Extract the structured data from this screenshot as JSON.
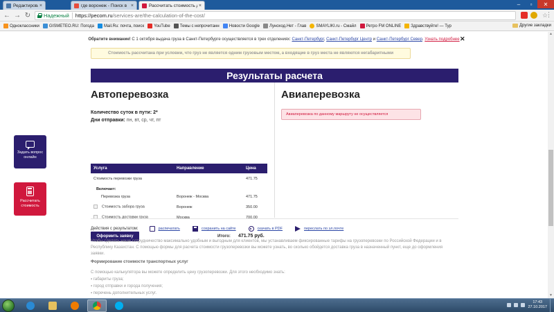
{
  "browser": {
    "tabs": [
      {
        "title": "Редактировать сообщ",
        "favicon_color": "#4a76a8",
        "active": false
      },
      {
        "title": "где воронеж - Поиск в",
        "favicon_color": "#e74c3c",
        "active": false
      },
      {
        "title": "Рассчитать стоимость д",
        "favicon_color": "#d0183d",
        "active": true
      }
    ],
    "security_label": "Надежный",
    "url_host": "https://pecom.ru",
    "url_path": "/services-are/the-calculation-of-the-cost/",
    "bookmarks": [
      {
        "label": "Одноклассники",
        "color": "#f7931e"
      },
      {
        "label": "GISMETEO.RU: Погода",
        "color": "#3b8fd6"
      },
      {
        "label": "Mail.Ru: почта, поиск",
        "color": "#168de2"
      },
      {
        "label": "YouTube",
        "color": "#e52d27"
      },
      {
        "label": "Темы с непрочитанн",
        "color": "#555555"
      },
      {
        "label": "Новости Google",
        "color": "#4285f4"
      },
      {
        "label": "Луноход.Нет - Глав",
        "color": "#888888"
      },
      {
        "label": "SMAYLIKI.ru - Смайл",
        "color": "#f4b400"
      },
      {
        "label": "Ретро FM ONLINE",
        "color": "#d0183d"
      },
      {
        "label": "Здравствуйте! — Тур",
        "color": "#f4b400"
      }
    ],
    "bookmarks_other": "Другие закладки"
  },
  "notice": {
    "bold": "Обратите внимание!",
    "text": " С 1 октября выдача груза в Санкт-Петербурге осуществляется в трех отделениях: ",
    "link1": "Санкт-Петербург",
    "comma": ", ",
    "link2": "Санкт-Петербург Центр",
    "and": " и ",
    "link3": "Санкт-Петербург Север",
    "dot": ". ",
    "more": "Узнать подробнее"
  },
  "warning": "Стоимость рассчитана при условии, что груз не является одним грузовым местом, а входящие в груз места не являются негабаритными",
  "results_title": "Результаты расчета",
  "auto": {
    "title": "Автоперевозка",
    "days_label": "Количество суток в пути:",
    "days_value": "2*",
    "departure_label": "Дни отправки:",
    "departure_value": "пн, вт, ср, чт, пт",
    "table": {
      "headers": [
        "Услуга",
        "Направление",
        "Цена"
      ],
      "row_main": {
        "service": "Стоимость перевозки груза",
        "direction": "",
        "price": "471.75"
      },
      "includes_label": "Включает:",
      "row_incl": {
        "service": "Перевозка груза",
        "direction": "Воронеж - Москва",
        "price": "471.75"
      },
      "row_pickup": {
        "service": "Стоимость забора груза",
        "direction": "Воронеж",
        "price": "350.00"
      },
      "row_delivery": {
        "service": "Стоимость доставки груза",
        "direction": "Москва",
        "price": "700.00"
      }
    },
    "order_button": "Оформить заявку",
    "total_label": "Итого:",
    "total_value": "471.75 руб."
  },
  "avia": {
    "title": "Авиаперевозка",
    "message": "Авиаперевозка по данному маршруту не осуществляется"
  },
  "actions": {
    "label": "Действия с результатом:",
    "print": "распечатать",
    "save": "сохранить на сайте",
    "pdf": "скачать в PDF",
    "send": "переслать по эл.почте"
  },
  "intro_text": "Чтобы сделать наше сотрудничество максимально удобным и выгодным для клиентов, мы устанавливаем фиксированные тарифы на грузоперевозки по Российской Федерации и в Республику Казахстан. С помощью формы для расчета стоимости грузоперевозки вы можете узнать, во сколько обойдется доставка груза в назначенный пункт, еще до оформления заявки.",
  "subheading": "Формирование стоимости транспортных услуг",
  "calc_intro": "С помощью калькулятора вы можете определить цену грузоперевозки. Для этого необходимо знать:",
  "calc_items": [
    "габариты груза;",
    "город отправки и города получения;",
    "перечень дополнительных услуг."
  ],
  "widgets": {
    "question": "Задать вопрос онлайн",
    "calculate": "Рассчитать стоимость"
  },
  "taskbar": {
    "time": "17:43",
    "date": "27.10.2017"
  }
}
